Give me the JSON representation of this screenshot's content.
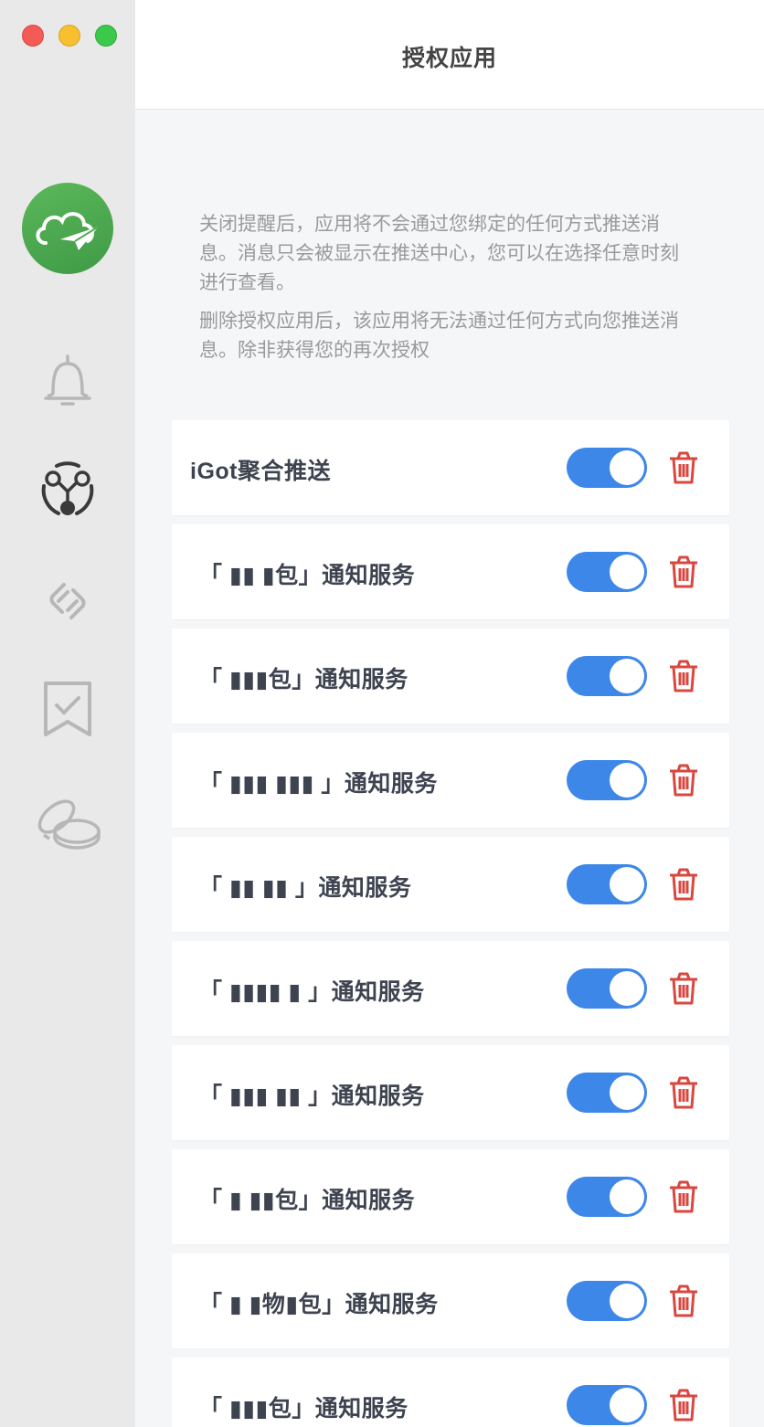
{
  "window": {
    "title": "授权应用"
  },
  "sidebar": {
    "icons": [
      "cloud-paper-plane-logo",
      "bell-icon",
      "hub-nodes-icon",
      "link-chain-icon",
      "bookmark-check-icon",
      "coins-icon"
    ]
  },
  "description": {
    "paragraph1": "关闭提醒后，应用将不会通过您绑定的任何方式推送消息。消息只会被显示在推送中心，您可以在选择任意时刻进行查看。",
    "paragraph2": "删除授权应用后，该应用将无法通过任何方式向您推送消息。除非获得您的再次授权"
  },
  "apps": [
    {
      "label": "iGot聚合推送",
      "enabled": true
    },
    {
      "label": "「 ▮▮ ▮包」通知服务",
      "enabled": true
    },
    {
      "label": "「 ▮▮▮包」通知服务",
      "enabled": true
    },
    {
      "label": "「 ▮▮▮ ▮▮▮ 」通知服务",
      "enabled": true
    },
    {
      "label": "「 ▮▮ ▮▮ 」通知服务",
      "enabled": true
    },
    {
      "label": "「 ▮▮▮▮ ▮ 」通知服务",
      "enabled": true
    },
    {
      "label": "「 ▮▮▮ ▮▮ 」通知服务",
      "enabled": true
    },
    {
      "label": "「 ▮ ▮▮包」通知服务",
      "enabled": true
    },
    {
      "label": "「 ▮ ▮物▮包」通知服务",
      "enabled": true
    },
    {
      "label": "「 ▮▮▮包」通知服务",
      "enabled": true
    }
  ],
  "colors": {
    "toggle_on": "#3d87e8",
    "trash": "#d9473f",
    "logo": "#4caf50"
  }
}
